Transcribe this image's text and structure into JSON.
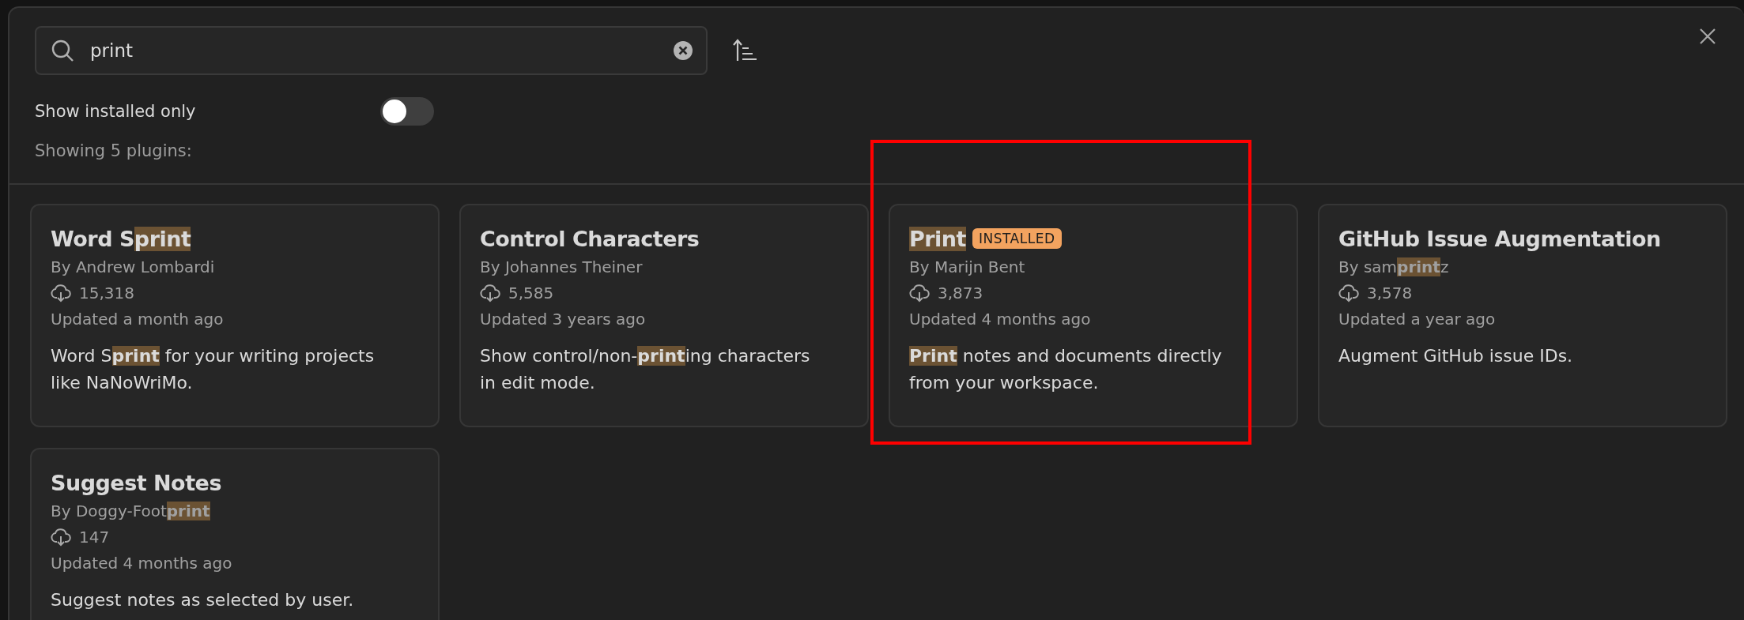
{
  "search": {
    "value": "print"
  },
  "toggle": {
    "label": "Show installed only",
    "on": false
  },
  "count": "Showing 5 plugins:",
  "plugins": [
    {
      "name": "Word S**print**",
      "author": "By Andrew Lombardi",
      "downloads": "15,318",
      "updated": "Updated a month ago",
      "description": "Word S**print** for your writing projects like NaNoWriMo.",
      "highlighted": false
    },
    {
      "name": "Control Characters",
      "author": "By Johannes Theiner",
      "downloads": "5,585",
      "updated": "Updated 3 years ago",
      "description": "Show control/non-**print**ing characters in edit mode.",
      "highlighted": false
    },
    {
      "name": "**Print**",
      "badge": "INSTALLED",
      "author": "By Marijn Bent",
      "downloads": "3,873",
      "updated": "Updated 4 months ago",
      "description": "**Print** notes and documents directly from your workspace.",
      "highlighted": true
    },
    {
      "name": "GitHub Issue Augmentation",
      "author": "By sam**print**z",
      "downloads": "3,578",
      "updated": "Updated a year ago",
      "description": "Augment GitHub issue IDs.",
      "highlighted": false
    },
    {
      "name": "Suggest Notes",
      "author": "By Doggy-Foot**print**",
      "downloads": "147",
      "updated": "Updated 4 months ago",
      "description": "Suggest notes as selected by user.",
      "highlighted": false
    }
  ]
}
